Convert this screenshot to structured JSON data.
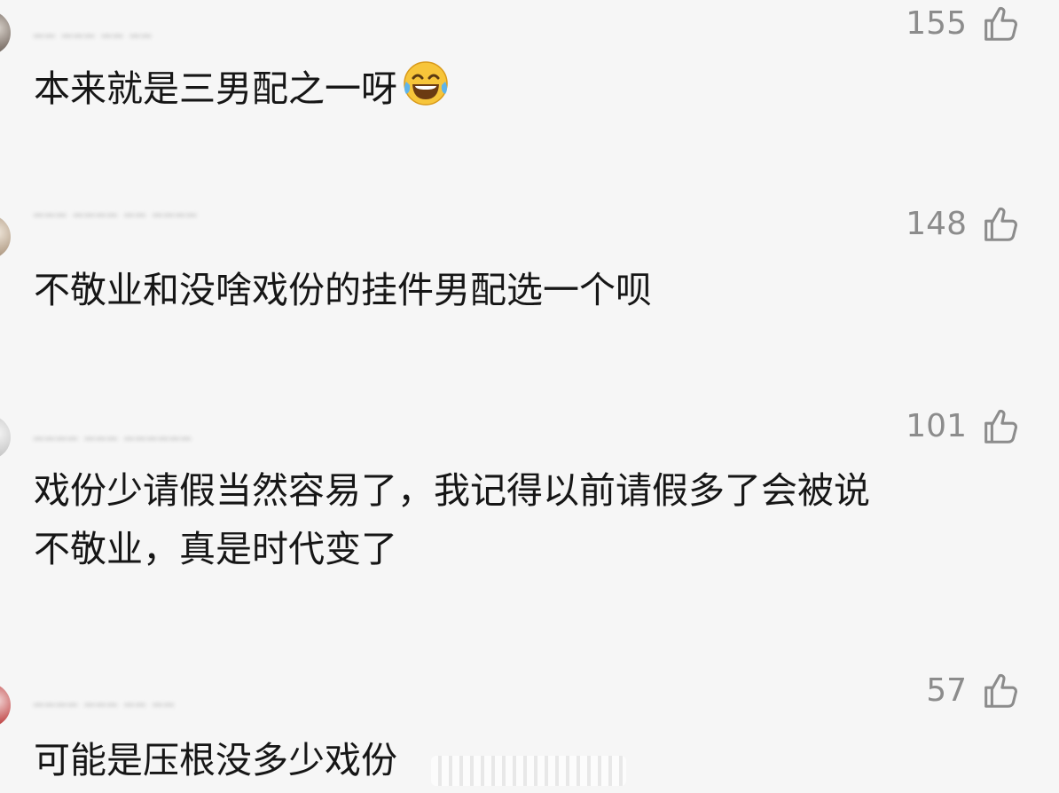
{
  "comments": [
    {
      "username": "▂▂ ▂▂▂ ▂▂ ▂▂",
      "likes": "155",
      "lines": [
        "本来就是三男配之一呀"
      ],
      "emoji": "tears-of-joy-emoji"
    },
    {
      "username": "▂▂▂ ▂▂▂▂ ▂▂ ▂▂▂▂",
      "likes": "148",
      "lines": [
        "不敬业和没啥戏份的挂件男配选一个呗"
      ]
    },
    {
      "username": "▂▂▂▂ ▂▂▂ ▂▂▂▂▂▂",
      "likes": "101",
      "lines": [
        "戏份少请假当然容易了，我记得以前请假多了会被说",
        "不敬业，真是时代变了"
      ]
    },
    {
      "username": "▂▂▂▂ ▂▂▂ ▂▂ ▂▂",
      "likes": "57",
      "lines": [
        "可能是压根没多少戏份"
      ]
    }
  ],
  "icons": {
    "like": "thumbs-up-outline-icon",
    "emoji": "tears-of-joy-emoji"
  },
  "colors": {
    "background": "#f6f6f6",
    "text": "#161616",
    "like_count": "#8c8c8c"
  }
}
